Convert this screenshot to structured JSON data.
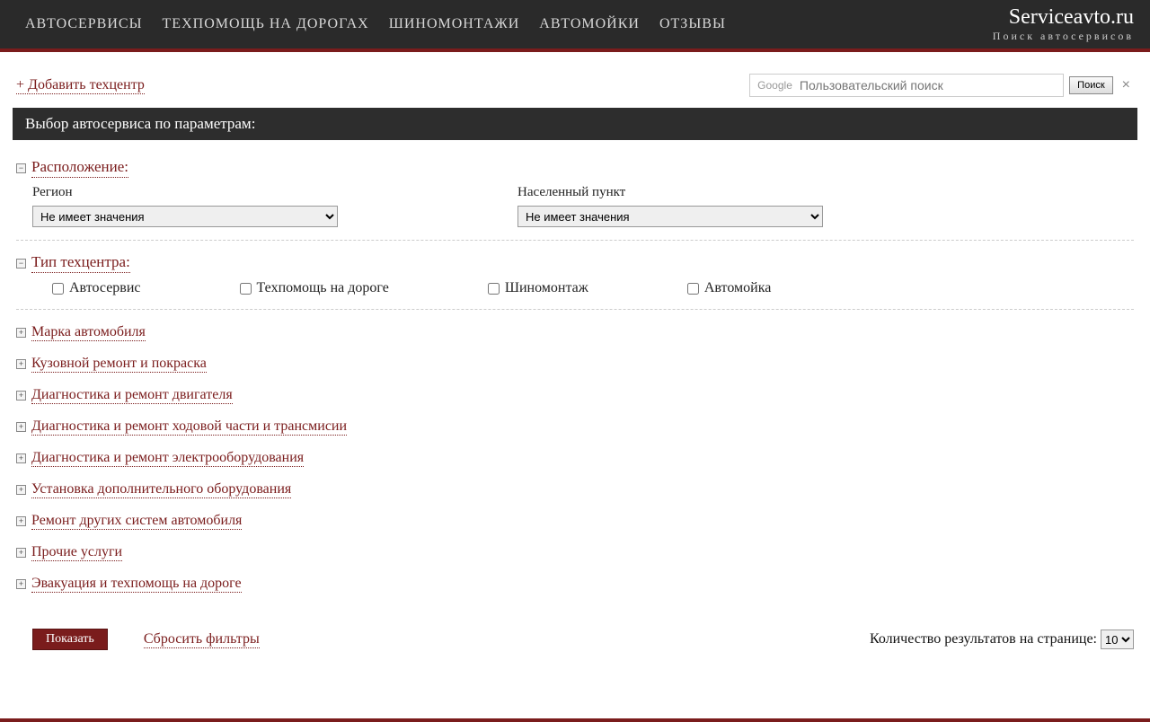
{
  "nav": {
    "items": [
      "АВТОСЕРВИСЫ",
      "ТЕХПОМОЩЬ НА ДОРОГАХ",
      "ШИНОМОНТАЖИ",
      "АВТОМОЙКИ",
      "ОТЗЫВЫ"
    ]
  },
  "brand": {
    "title": "Serviceavto.ru",
    "subtitle": "Поиск автосервисов"
  },
  "toprow": {
    "add_link": "Добавить техцентр"
  },
  "search": {
    "logo": "Google",
    "placeholder": "Пользовательский поиск",
    "button": "Поиск",
    "close": "×"
  },
  "filter_header": "Выбор автосервиса по параметрам:",
  "location": {
    "title": "Расположение:",
    "region_label": "Регион",
    "region_value": "Не имеет значения",
    "city_label": "Населенный пункт",
    "city_value": "Не имеет значения"
  },
  "type_section": {
    "title": "Тип техцентра:",
    "options": [
      "Автосервис",
      "Техпомощь на дороге",
      "Шиномонтаж",
      "Автомойка"
    ]
  },
  "collapsed": [
    "Марка автомобиля",
    "Кузовной ремонт и покраска",
    "Диагностика и ремонт двигателя",
    "Диагностика и ремонт ходовой части и трансмисии",
    "Диагностика и ремонт электрооборудования",
    "Установка дополнительного оборудования",
    "Ремонт других систем автомобиля",
    "Прочие услуги",
    "Эвакуация и техпомощь на дороге"
  ],
  "actions": {
    "show": "Показать",
    "reset": "Сбросить фильтры",
    "per_page_label": "Количество результатов на странице:",
    "per_page_value": "10"
  },
  "icons": {
    "minus": "−",
    "plus": "+"
  }
}
